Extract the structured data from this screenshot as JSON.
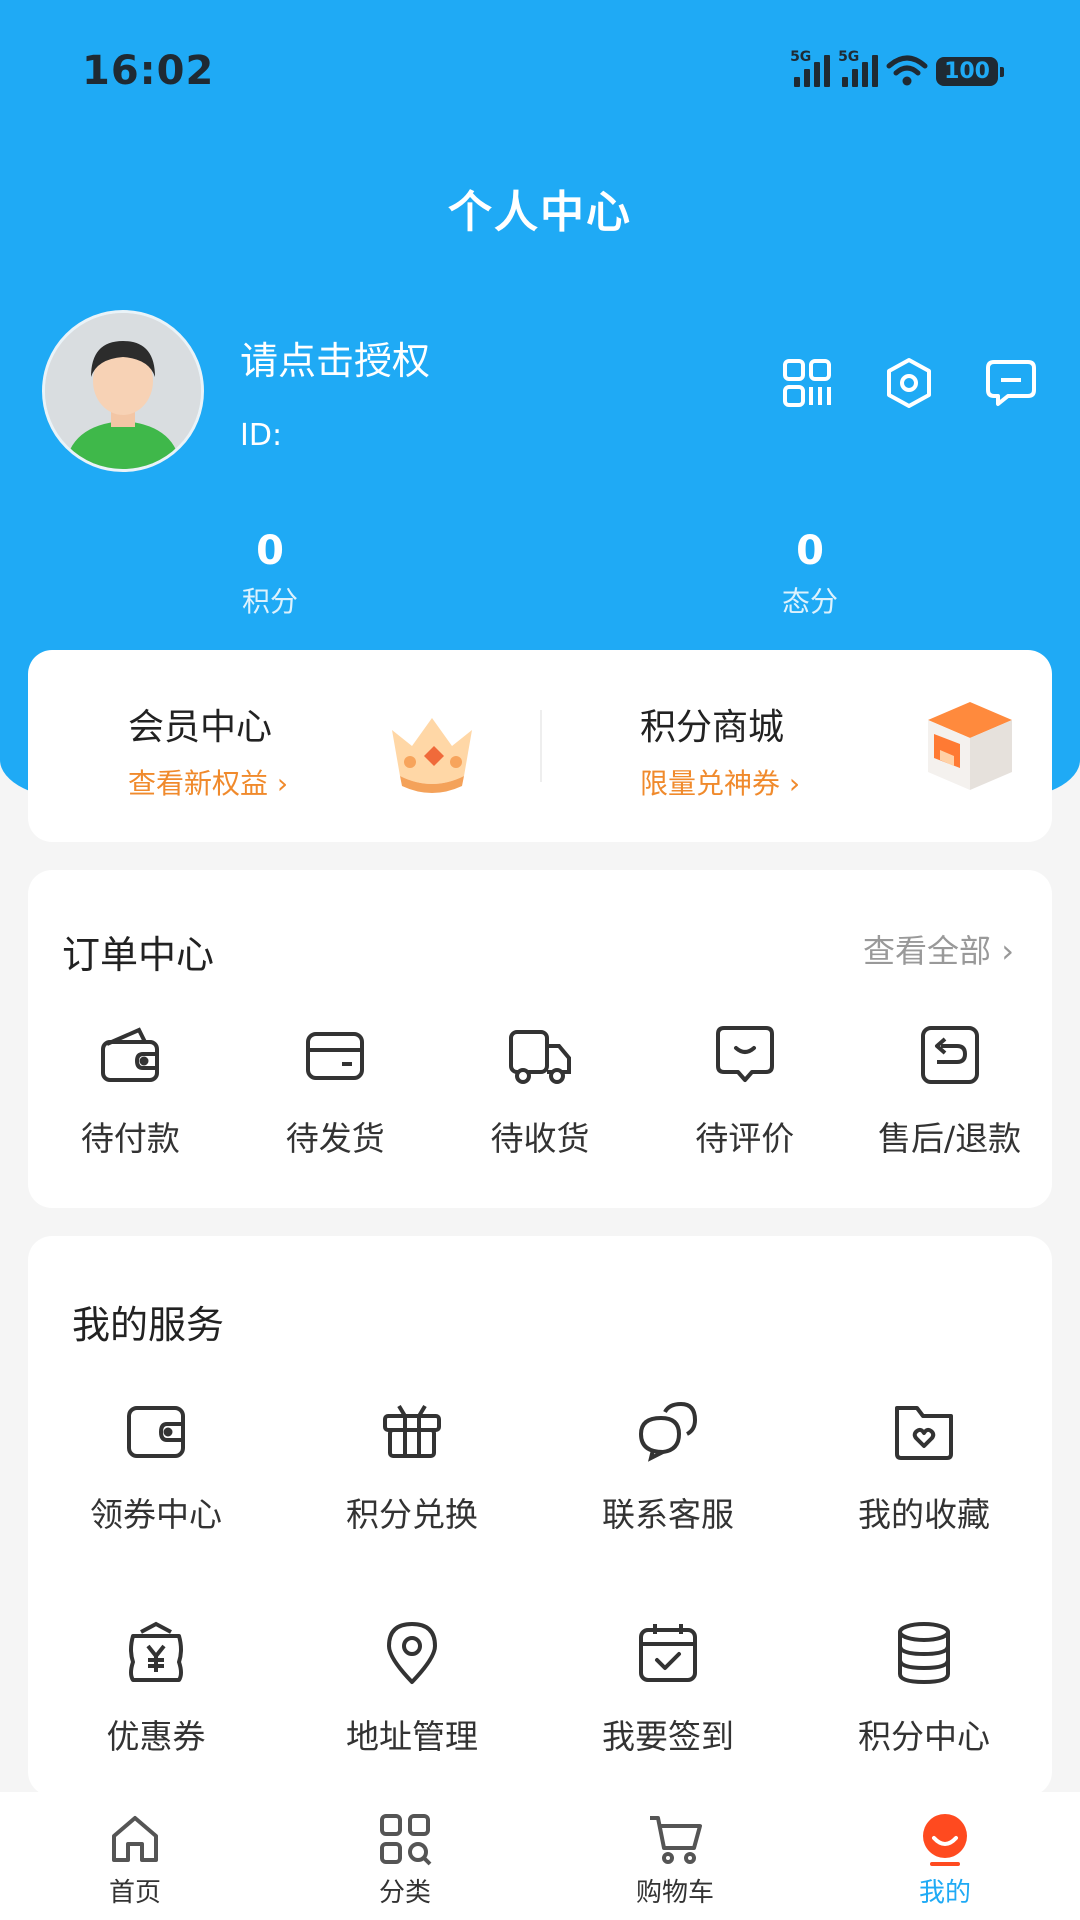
{
  "status_bar": {
    "time": "16:02",
    "network1": "5G",
    "network2": "5G",
    "battery": "100"
  },
  "header": {
    "title": "个人中心"
  },
  "profile": {
    "name": "请点击授权",
    "id_label": "ID:"
  },
  "stats": [
    {
      "value": "0",
      "label": "积分"
    },
    {
      "value": "0",
      "label": "态分"
    }
  ],
  "promo": [
    {
      "title": "会员中心",
      "subtitle": "查看新权益 ›",
      "icon": "crown-icon"
    },
    {
      "title": "积分商城",
      "subtitle": "限量兑神券 ›",
      "icon": "gift-box-icon"
    }
  ],
  "orders": {
    "title": "订单中心",
    "see_all": "查看全部 ›",
    "items": [
      {
        "label": "待付款",
        "icon": "wallet-icon"
      },
      {
        "label": "待发货",
        "icon": "card-icon"
      },
      {
        "label": "待收货",
        "icon": "truck-icon"
      },
      {
        "label": "待评价",
        "icon": "comment-icon"
      },
      {
        "label": "售后/退款",
        "icon": "return-icon"
      }
    ]
  },
  "services": {
    "title": "我的服务",
    "items": [
      {
        "label": "领券中心",
        "icon": "wallet-icon"
      },
      {
        "label": "积分兑换",
        "icon": "gift-icon"
      },
      {
        "label": "联系客服",
        "icon": "chat-icon"
      },
      {
        "label": "我的收藏",
        "icon": "folder-heart-icon"
      },
      {
        "label": "优惠券",
        "icon": "yen-coupon-icon"
      },
      {
        "label": "地址管理",
        "icon": "location-icon"
      },
      {
        "label": "我要签到",
        "icon": "calendar-check-icon"
      },
      {
        "label": "积分中心",
        "icon": "database-icon"
      }
    ]
  },
  "tabbar": [
    {
      "label": "首页",
      "icon": "home-icon"
    },
    {
      "label": "分类",
      "icon": "grid-search-icon"
    },
    {
      "label": "购物车",
      "icon": "cart-icon"
    },
    {
      "label": "我的",
      "icon": "profile-face-icon"
    }
  ],
  "colors": {
    "primary": "#1faaf5",
    "accent": "#f08a2c",
    "background": "#f5f5f5"
  }
}
